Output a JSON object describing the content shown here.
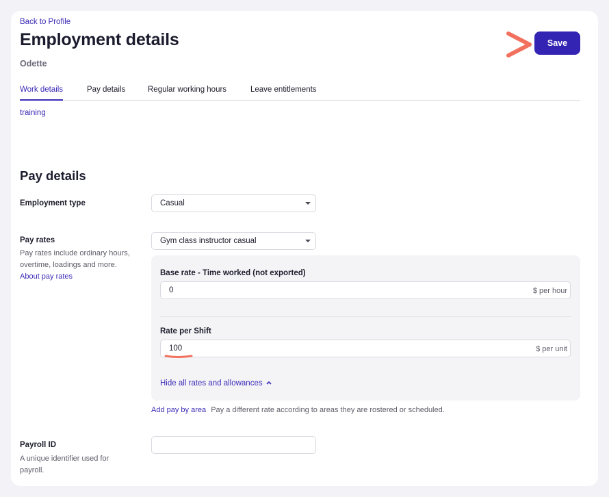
{
  "header": {
    "back_link": "Back to Profile",
    "title": "Employment details",
    "employee_name": "Odette",
    "save_label": "Save"
  },
  "tabs": [
    {
      "label": "Work details",
      "active": true
    },
    {
      "label": "Pay details",
      "active": false
    },
    {
      "label": "Regular working hours",
      "active": false
    },
    {
      "label": "Leave entitlements",
      "active": false
    }
  ],
  "work_details": {
    "training_link": "training"
  },
  "pay_details": {
    "section_title": "Pay details",
    "employment_type": {
      "label": "Employment type",
      "value": "Casual"
    },
    "pay_rates": {
      "label": "Pay rates",
      "help_text": "Pay rates include ordinary hours, overtime, loadings and more.",
      "help_link": "About pay rates",
      "selected": "Gym class instructor casual",
      "rates": [
        {
          "label": "Base rate - Time worked (not exported)",
          "value": "0",
          "unit": "$ per hour"
        },
        {
          "label": "Rate per Shift",
          "value": "100",
          "unit": "$ per unit"
        }
      ],
      "toggle_label": "Hide all rates and allowances",
      "toggle_icon": "chevron-up-icon"
    },
    "add_pay_by_area": {
      "link": "Add pay by area",
      "description": "Pay a different rate according to areas they are rostered or scheduled."
    },
    "payroll_id": {
      "label": "Payroll ID",
      "help_text": "A unique identifier used for payroll.",
      "value": ""
    }
  },
  "annotations": {
    "arrow_color": "#f2715e",
    "underline_color": "#f2715e"
  },
  "colors": {
    "accent": "#3b2bb5",
    "save_button": "#3424b3",
    "background": "#f3f3f7"
  }
}
